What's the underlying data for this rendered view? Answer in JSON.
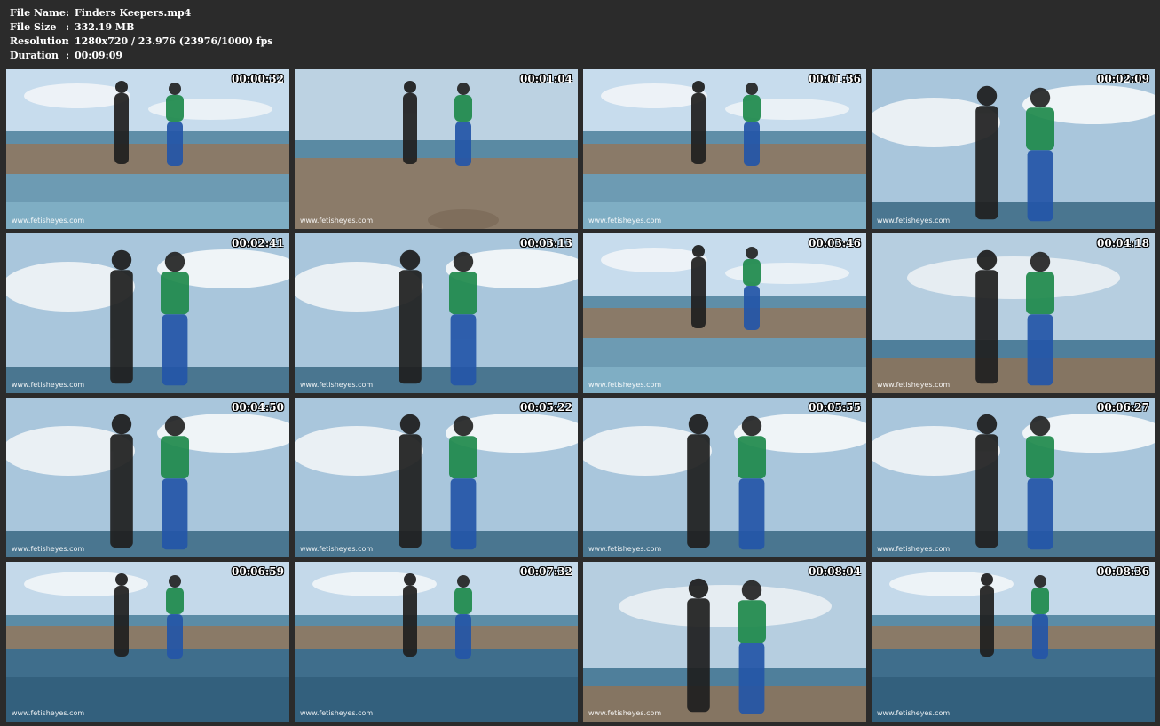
{
  "file_info": [
    {
      "key": "File Name",
      "sep": ":",
      "value": "Finders Keepers.mp4"
    },
    {
      "key": "File Size",
      "sep": ":",
      "value": "332.19 MB"
    },
    {
      "key": "Resolution",
      "sep": ":",
      "value": "1280x720 / 23.976 (23976/1000) fps"
    },
    {
      "key": "Duration",
      "sep": ":",
      "value": "00:09:09"
    }
  ],
  "watermark": "www.fetisheyes.com",
  "thumbnails": [
    {
      "timestamp": "00:00:32",
      "scene": "wide-pool"
    },
    {
      "timestamp": "00:01:04",
      "scene": "sitting"
    },
    {
      "timestamp": "00:01:36",
      "scene": "wide-pool"
    },
    {
      "timestamp": "00:02:09",
      "scene": "sky-closeup"
    },
    {
      "timestamp": "00:02:41",
      "scene": "sky-closeup"
    },
    {
      "timestamp": "00:03:13",
      "scene": "sky-closeup"
    },
    {
      "timestamp": "00:03:46",
      "scene": "wide-pool"
    },
    {
      "timestamp": "00:04:18",
      "scene": "shore-medium"
    },
    {
      "timestamp": "00:04:50",
      "scene": "sky-closeup"
    },
    {
      "timestamp": "00:05:22",
      "scene": "sky-closeup"
    },
    {
      "timestamp": "00:05:55",
      "scene": "sky-closeup"
    },
    {
      "timestamp": "00:06:27",
      "scene": "sky-closeup"
    },
    {
      "timestamp": "00:06:59",
      "scene": "water-wide"
    },
    {
      "timestamp": "00:07:32",
      "scene": "water-wide"
    },
    {
      "timestamp": "00:08:04",
      "scene": "shore-medium"
    },
    {
      "timestamp": "00:08:36",
      "scene": "water-wide"
    }
  ]
}
